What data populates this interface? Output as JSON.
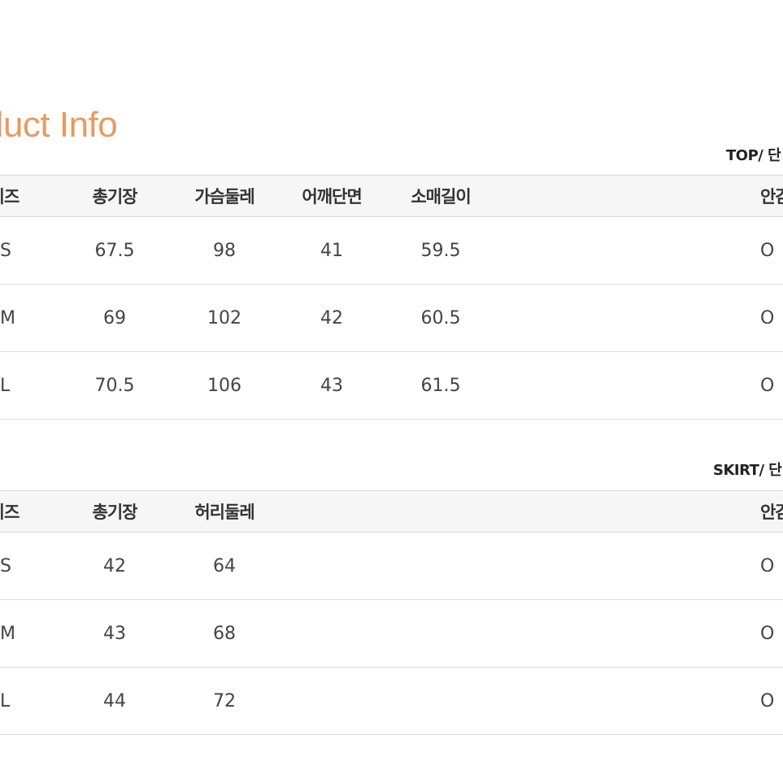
{
  "title": "oduct Info",
  "top": {
    "unit_label": "TOP/ 단",
    "headers": [
      "이즈",
      "총기장",
      "가슴둘레",
      "어깨단면",
      "소매길이",
      "안감"
    ],
    "rows": [
      [
        "S",
        "67.5",
        "98",
        "41",
        "59.5",
        "O"
      ],
      [
        "M",
        "69",
        "102",
        "42",
        "60.5",
        "O"
      ],
      [
        "L",
        "70.5",
        "106",
        "43",
        "61.5",
        "O"
      ]
    ]
  },
  "skirt": {
    "unit_label": "SKIRT/ 단",
    "headers": [
      "이즈",
      "총기장",
      "허리둘레",
      "안감"
    ],
    "rows": [
      [
        "S",
        "42",
        "64",
        "O"
      ],
      [
        "M",
        "43",
        "68",
        "O"
      ],
      [
        "L",
        "44",
        "72",
        "O"
      ]
    ]
  },
  "colors": {
    "title": "#e89a5c",
    "header_bg": "#f6f6f6",
    "border": "#d9d9d9"
  }
}
